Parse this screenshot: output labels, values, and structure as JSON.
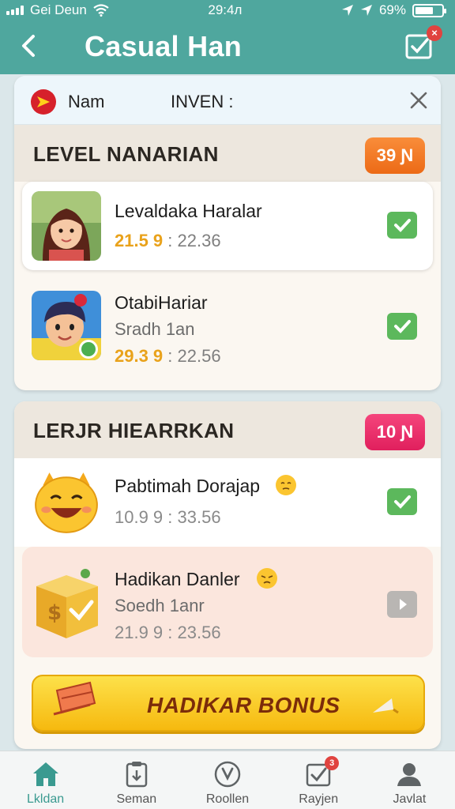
{
  "status_bar": {
    "carrier": "Gei Deun",
    "time": "29:4л",
    "battery": "69%",
    "battery_level": 0.69
  },
  "header": {
    "title": "Casual Han",
    "tasks_badge": "×"
  },
  "panel": {
    "name": "Nam",
    "inven": "INVEN :"
  },
  "section1": {
    "title": "LEVEL NANARIAN",
    "pill": "39 Ɲ",
    "items": [
      {
        "title": "Levaldaka Haralar",
        "time_hi": "21.5 9",
        "time_rest": " : 22.36"
      },
      {
        "title": "OtabiHariar",
        "sub": "Sradh 1an",
        "time_hi": "29.3 9",
        "time_rest": " : 22.56"
      }
    ]
  },
  "section2": {
    "title": "LERJR HIEARRKAN",
    "pill": "10 Ɲ",
    "items": [
      {
        "title": "Pabtimah Dorajap",
        "time": "10.9 9 : 33.56"
      },
      {
        "title": "Hadikan Danler",
        "sub": "Soedh 1anr",
        "time": "21.9 9 : 23.56"
      }
    ],
    "bonus_label": "HADIKAR BONUS"
  },
  "nav": [
    {
      "label": "Lkldan",
      "icon": "home-icon"
    },
    {
      "label": "Seman",
      "icon": "clipboard-icon"
    },
    {
      "label": "Roollen",
      "icon": "compass-icon"
    },
    {
      "label": "Rayjen",
      "icon": "checkbox-icon",
      "badge": "3"
    },
    {
      "label": "Javlat",
      "icon": "profile-icon"
    }
  ],
  "colors": {
    "accent": "#4fa79e",
    "check": "#5cb85c",
    "orange_pill": "#ec6a16",
    "pink_pill": "#e01f5d",
    "bonus": "#f6b90f"
  }
}
